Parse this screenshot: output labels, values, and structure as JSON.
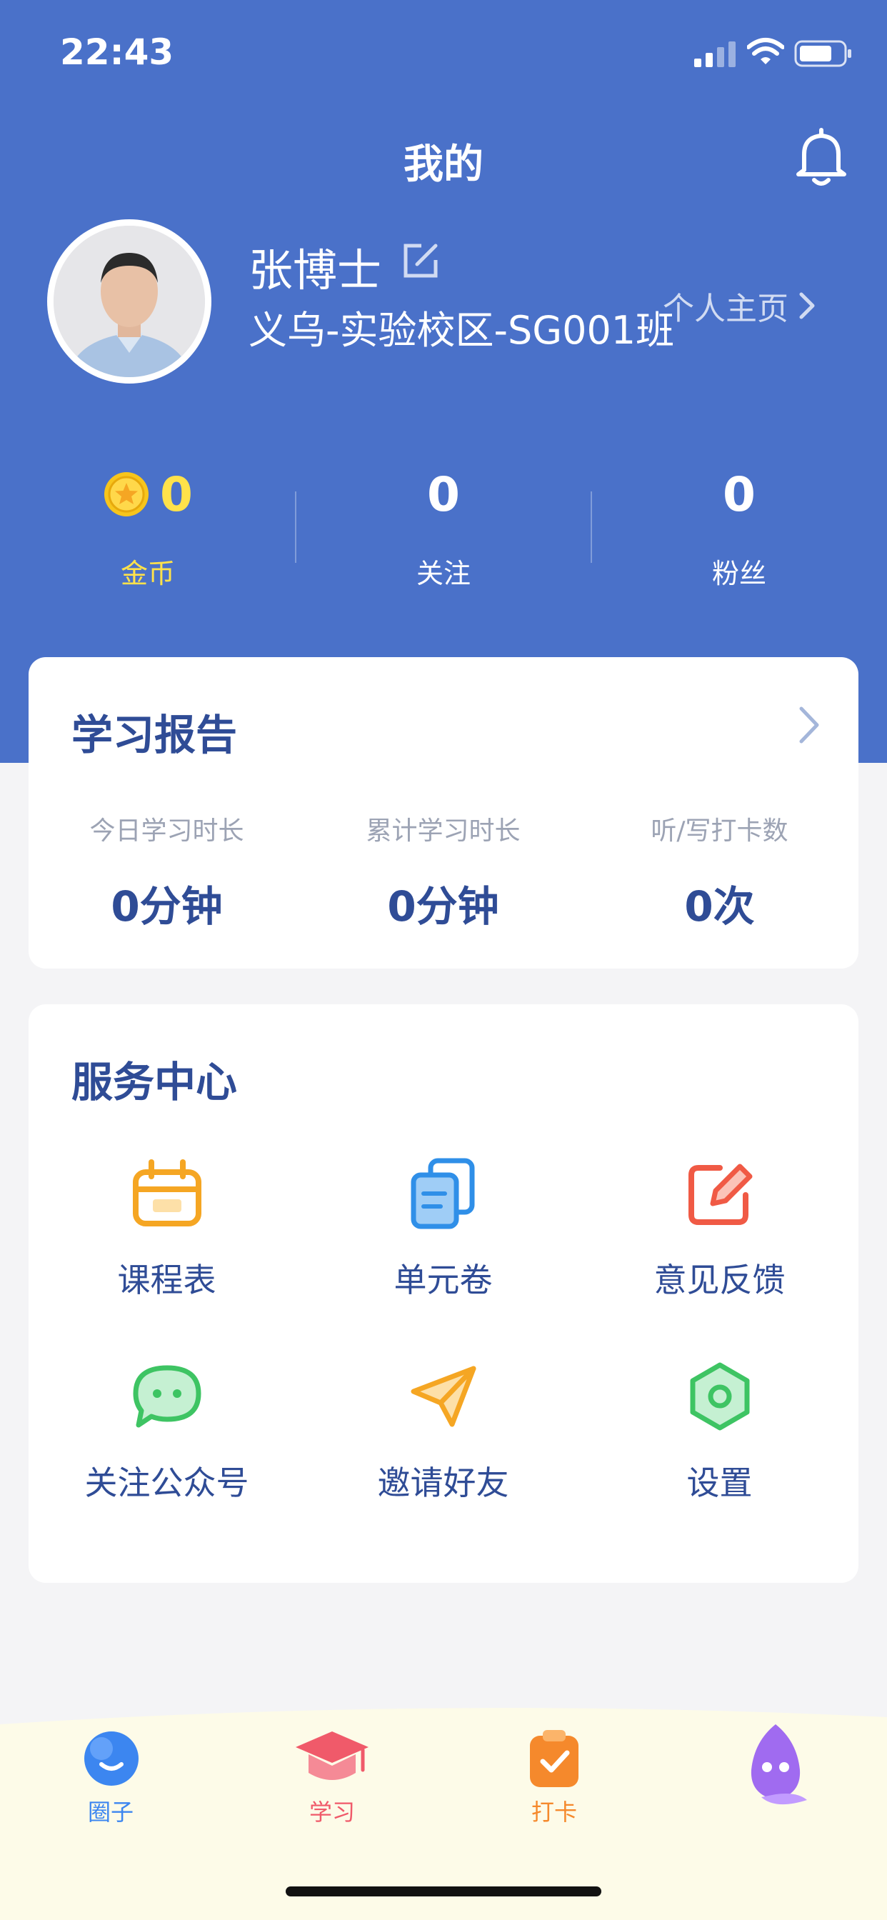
{
  "status_bar": {
    "time": "22:43"
  },
  "header": {
    "title": "我的"
  },
  "profile": {
    "name": "张博士",
    "class_name": "义乌-实验校区-SG001班",
    "homepage_link": "个人主页"
  },
  "stats": [
    {
      "value": "0",
      "label": "金币"
    },
    {
      "value": "0",
      "label": "关注"
    },
    {
      "value": "0",
      "label": "粉丝"
    }
  ],
  "report": {
    "title": "学习报告",
    "items": [
      {
        "label": "今日学习时长",
        "value": "0分钟"
      },
      {
        "label": "累计学习时长",
        "value": "0分钟"
      },
      {
        "label": "听/写打卡数",
        "value": "0次"
      }
    ]
  },
  "services": {
    "title": "服务中心",
    "items": [
      {
        "label": "课程表",
        "icon": "calendar-icon",
        "color": "#f5a623"
      },
      {
        "label": "单元卷",
        "icon": "documents-icon",
        "color": "#2f8fe8"
      },
      {
        "label": "意见反馈",
        "icon": "edit-feedback-icon",
        "color": "#f05a45"
      },
      {
        "label": "关注公众号",
        "icon": "chat-bubble-icon",
        "color": "#3ec463"
      },
      {
        "label": "邀请好友",
        "icon": "paper-plane-icon",
        "color": "#f5a623"
      },
      {
        "label": "设置",
        "icon": "hexagon-gear-icon",
        "color": "#3ec463"
      }
    ]
  },
  "tabbar": {
    "items": [
      {
        "label": "圈子",
        "color": "#3c86f0",
        "icon": "circle-bubble-icon"
      },
      {
        "label": "学习",
        "color": "#f05a6a",
        "icon": "graduation-cap-icon"
      },
      {
        "label": "打卡",
        "color": "#f5892c",
        "icon": "clipboard-check-icon"
      },
      {
        "label": "",
        "color": "#a06bf0",
        "icon": "robot-mascot-icon"
      }
    ]
  },
  "colors": {
    "header_bg": "#4a71c9",
    "primary_text": "#2f4c96",
    "coin": "#ffe24a",
    "page_bg": "#f4f4f6"
  }
}
